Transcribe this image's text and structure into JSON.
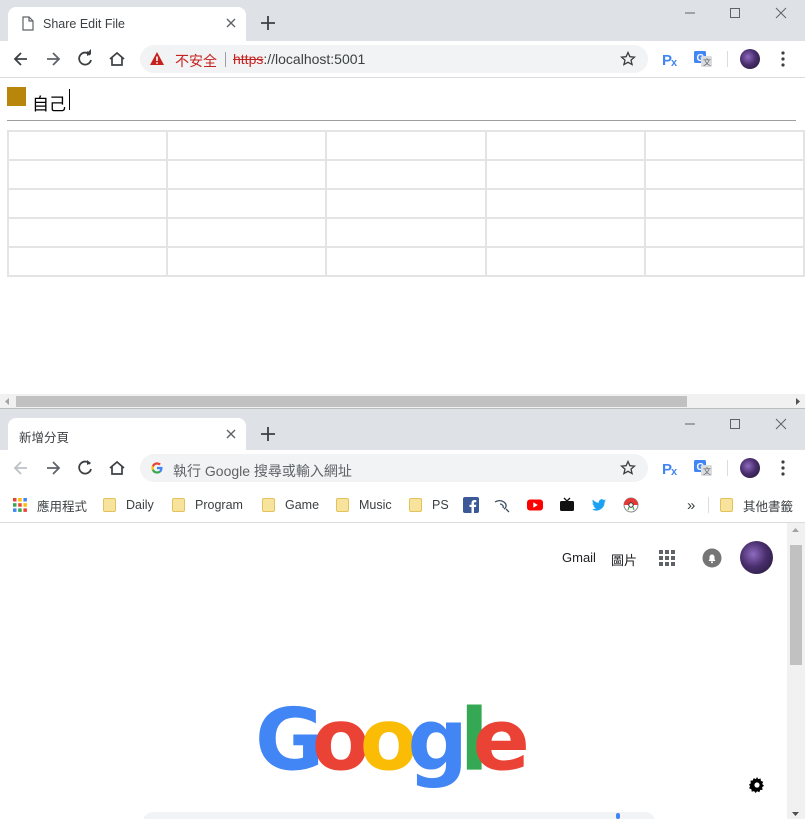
{
  "window1": {
    "tab_title": "Share Edit File",
    "omnibox": {
      "warning": "不安全",
      "scheme": "https",
      "url_rest": "://localhost:5001"
    },
    "editor": {
      "swatch_color": "#b8860b",
      "text": "自己"
    },
    "table": {
      "rows": 5,
      "columns": 5
    }
  },
  "window2": {
    "tab_title": "新增分頁",
    "omnibox_placeholder": "執行 Google 搜尋或輸入網址",
    "bookmarks": {
      "apps_label": "應用程式",
      "folders": [
        "Daily",
        "Program",
        "Game",
        "Music",
        "PS"
      ],
      "icons": [
        "facebook-icon",
        "kali-dragon-icon",
        "youtube-icon",
        "tv-icon",
        "twitter-icon",
        "pokeball-icon"
      ],
      "overflow": "»",
      "other_bookmarks": "其他書籤"
    },
    "google": {
      "links": {
        "gmail": "Gmail",
        "images": "圖片"
      },
      "logo_text": "Google",
      "logo_colors": [
        "#4285f4",
        "#ea4335",
        "#fbbc05",
        "#4285f4",
        "#34a853",
        "#ea4335"
      ]
    }
  }
}
